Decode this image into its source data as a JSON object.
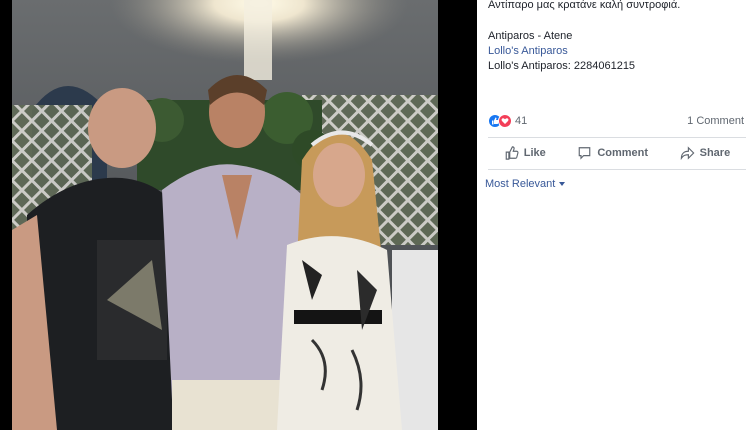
{
  "post": {
    "caption_line1": "Αντίπαρο μας κρατάνε καλή συντροφιά.",
    "caption_line2": "Antiparos - Atene",
    "page_link": "Lollo's Antiparos",
    "phone_line": "Lollo's Antiparos: 2284061215"
  },
  "reactions": {
    "icons": [
      "like-icon",
      "love-icon"
    ],
    "count": "41",
    "comments": "1 Comment"
  },
  "actions": {
    "like": "Like",
    "comment": "Comment",
    "share": "Share"
  },
  "comments_filter": {
    "selected": "Most Relevant"
  },
  "colors": {
    "link": "#385898",
    "like_blue": "#1877f2",
    "love_red": "#f33e58"
  }
}
